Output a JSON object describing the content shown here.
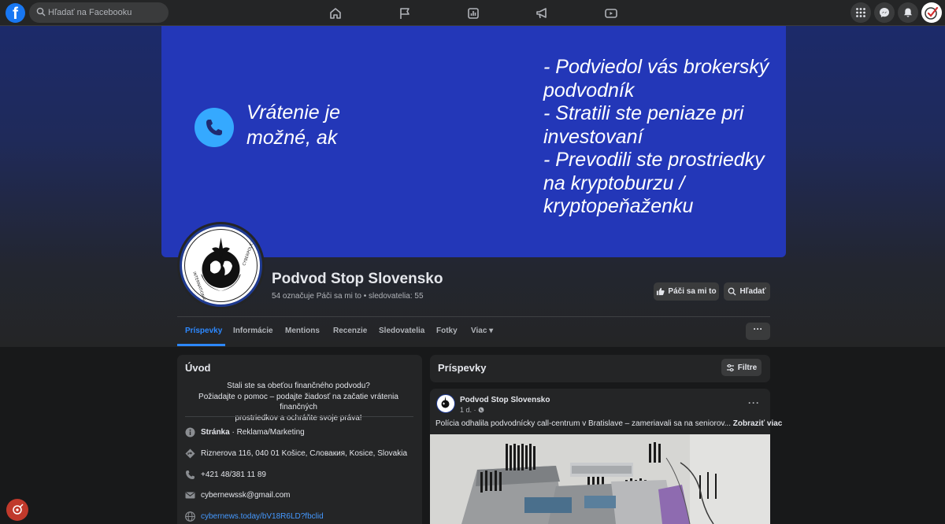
{
  "topbar": {
    "logo": "f",
    "search_placeholder": "Hľadať na Facebooku",
    "nav_icons": [
      "home-icon",
      "flag-icon",
      "insights-icon",
      "megaphone-icon",
      "video-icon"
    ],
    "right_icons": [
      "menu-grid-icon",
      "messenger-icon",
      "bell-icon"
    ]
  },
  "cover": {
    "left_text": "Vrátenie je\nmožné, ak",
    "right_text": "- Podviedol vás brokerský\npodvodník\n- Stratili ste peniaze pri\ninvestovaní\n- Prevodili ste prostriedky\nna kryptoburzu /\nkryptopeňaženku",
    "bg_color": "#2337b8",
    "phone_icon_color": "#35a9ff"
  },
  "profile": {
    "name": "Podvod Stop Slovensko",
    "stats": "54 označuje Páči sa mi to • sledovatelia: 55",
    "logo_text_left": "INTERNATIONAL",
    "logo_text_right": "CYBERPOLICE"
  },
  "actions": {
    "like_label": "Páči sa mi to",
    "search_label": "Hľadať",
    "more_label": "···"
  },
  "tabs": [
    {
      "label": "Príspevky",
      "active": true
    },
    {
      "label": "Informácie"
    },
    {
      "label": "Mentions"
    },
    {
      "label": "Recenzie"
    },
    {
      "label": "Sledovatelia"
    },
    {
      "label": "Fotky"
    },
    {
      "label": "Viac ▾"
    }
  ],
  "intro": {
    "title": "Úvod",
    "bio": "Stali ste sa obeťou finančného podvodu?\nPožiadajte o pomoc – podajte žiadosť na začatie vrátenia finančných\nprostriedkov a ochráňte svoje práva!",
    "category_label": "Stránka",
    "category_value": " · Reklama/Marketing",
    "address": "Riznerova 116, 040 01 Košice, Словакия, Kosice, Slovakia",
    "phone": "+421 48/381 11 89",
    "email": "cybernewssk@gmail.com",
    "website": "cybernews.today/bV18R6LD?fbclid"
  },
  "posts": {
    "section_title": "Príspevky",
    "filter_label": "Filtre",
    "author": "Podvod Stop Slovensko",
    "time": "1 d. ·",
    "text": "Polícia odhalila podvodnícky call-centrum v Bratislave – zameriavali sa na seniorov...",
    "see_more": "Zobraziť viac",
    "more_label": "···"
  },
  "colors": {
    "accent": "#2d88ff",
    "link": "#4599ff",
    "background": "#18191a",
    "card": "#242526"
  }
}
